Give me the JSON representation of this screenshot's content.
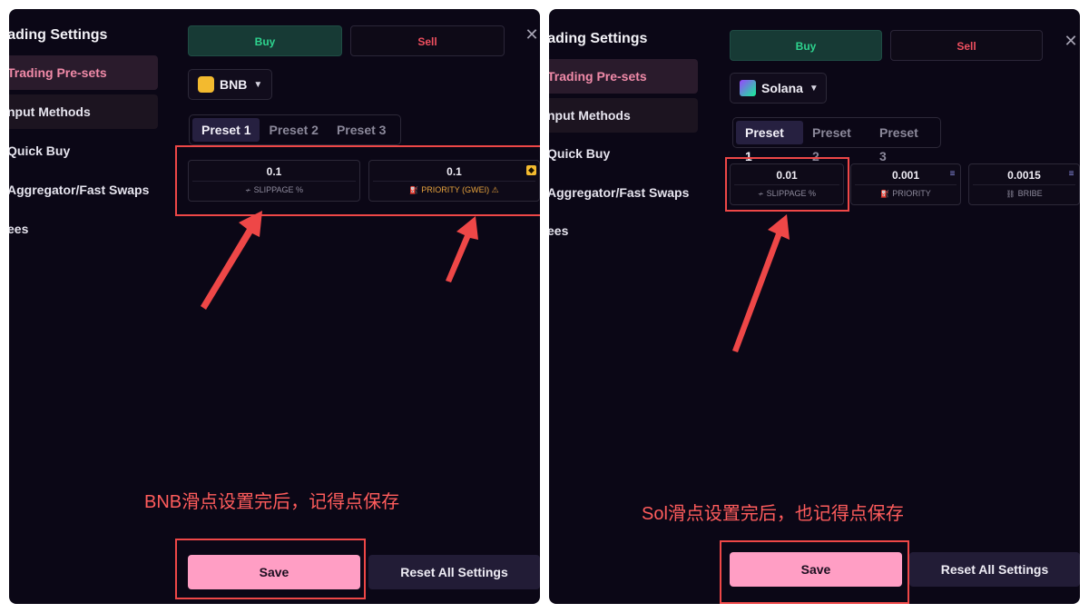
{
  "left": {
    "sidebar": {
      "title": "rading Settings",
      "items": [
        "Trading Pre-sets",
        "nput Methods",
        "Quick Buy",
        "Aggregator/Fast Swaps",
        "ees"
      ]
    },
    "buy_label": "Buy",
    "sell_label": "Sell",
    "chain": "BNB",
    "tabs": [
      "Preset 1",
      "Preset 2",
      "Preset 3"
    ],
    "fields": [
      {
        "value": "0.1",
        "label": "SLIPPAGE %"
      },
      {
        "value": "0.1",
        "label": "PRIORITY (GWEI)"
      }
    ],
    "note": "BNB滑点设置完后，记得点保存",
    "save_label": "Save",
    "reset_label": "Reset All Settings"
  },
  "right": {
    "sidebar": {
      "title": "rading Settings",
      "items": [
        "Trading Pre-sets",
        "nput Methods",
        "Quick Buy",
        "Aggregator/Fast Swaps",
        "ees"
      ]
    },
    "buy_label": "Buy",
    "sell_label": "Sell",
    "chain": "Solana",
    "tabs": [
      "Preset 1",
      "Preset 2",
      "Preset 3"
    ],
    "fields": [
      {
        "value": "0.01",
        "label": "SLIPPAGE %"
      },
      {
        "value": "0.001",
        "label": "PRIORITY"
      },
      {
        "value": "0.0015",
        "label": "BRIBE"
      }
    ],
    "note": "Sol滑点设置完后，也记得点保存",
    "save_label": "Save",
    "reset_label": "Reset All Settings"
  },
  "colors": {
    "panel_bg": "#0b0716",
    "buy": "#2ed38e",
    "sell": "#ef4f5f",
    "save": "#ff9ec4",
    "annotation": "#ee4747"
  }
}
